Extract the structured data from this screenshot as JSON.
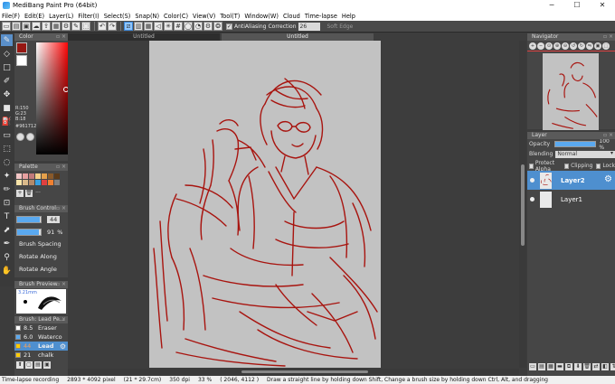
{
  "window": {
    "title": "MediBang Paint Pro (64bit)",
    "controls": [
      "─",
      "☐",
      "✕"
    ]
  },
  "menu": [
    "File(F)",
    "Edit(E)",
    "Layer(L)",
    "Filter(I)",
    "Select(S)",
    "Snap(N)",
    "Color(C)",
    "View(V)",
    "Tool(T)",
    "Window(W)",
    "Cloud",
    "Time-lapse",
    "Help"
  ],
  "toolbar": {
    "antialiasing_label": "AntiAliasing",
    "correction_label": "Correction",
    "correction_value": "26",
    "soft_edge_label": "Soft Edge"
  },
  "color_panel": {
    "title": "Color",
    "r": "R:150",
    "g": "G:23",
    "b": "B:18",
    "hex": "#961712",
    "fg_color": "#961712",
    "bg_color": "#ffffff"
  },
  "palette": {
    "title": "Palette",
    "colors": [
      "#f2c6c6",
      "#e8a0a0",
      "#c27a7a",
      "#f5d08a",
      "#e6a04a",
      "#8a5a2a",
      "#5a3a1a",
      "#f7e3a8",
      "#d9b98a",
      "#b48a6a",
      "#3aa0e0",
      "#e04040",
      "#f08030",
      "#808080"
    ]
  },
  "brush_control": {
    "title": "Brush Control",
    "size_value": "44",
    "size_fraction": 0.95,
    "opacity_value": "91",
    "opacity_unit": "%",
    "opacity_fraction": 0.91,
    "spacing_label": "Brush Spacing",
    "rotate_along_label": "Rotate Along",
    "rotate_angle_label": "Rotate Angle"
  },
  "brush_preview": {
    "title": "Brush Preview",
    "size_text": "3.21mm"
  },
  "brush_list": {
    "title": "Brush: Lead Pe...",
    "items": [
      {
        "size": "8.5",
        "name": "Eraser",
        "color": "#ffffff"
      },
      {
        "size": "6.0",
        "name": "Waterco",
        "color": "#5aa9f0"
      },
      {
        "size": "44",
        "name": "Lead",
        "color": "#ffcc00"
      },
      {
        "size": "21",
        "name": "chalk",
        "color": "#ffcc00"
      }
    ]
  },
  "documents": {
    "tabs": [
      "Untitled",
      "Untitled"
    ]
  },
  "navigator": {
    "title": "Navigator"
  },
  "layer_panel": {
    "title": "Layer",
    "opacity_label": "Opacity",
    "opacity_value": "100 %",
    "blending_label": "Blending",
    "blending_value": "Normal",
    "protect_alpha_label": "Protect Alpha",
    "clipping_label": "Clipping",
    "lock_label": "Lock",
    "layers": [
      {
        "name": "Layer2",
        "selected": true
      },
      {
        "name": "Layer1",
        "selected": false
      }
    ]
  },
  "statusbar": {
    "recording": "Time-lapse recording",
    "size": "2893 * 4092 pixel",
    "cm": "(21 * 29.7cm)",
    "dpi": "350 dpi",
    "zoom": "33 %",
    "coords": "( 2046, 4112 )",
    "hint": "Draw a straight line by holding down Shift, Change a brush size by holding down Ctrl, Alt, and dragging"
  }
}
